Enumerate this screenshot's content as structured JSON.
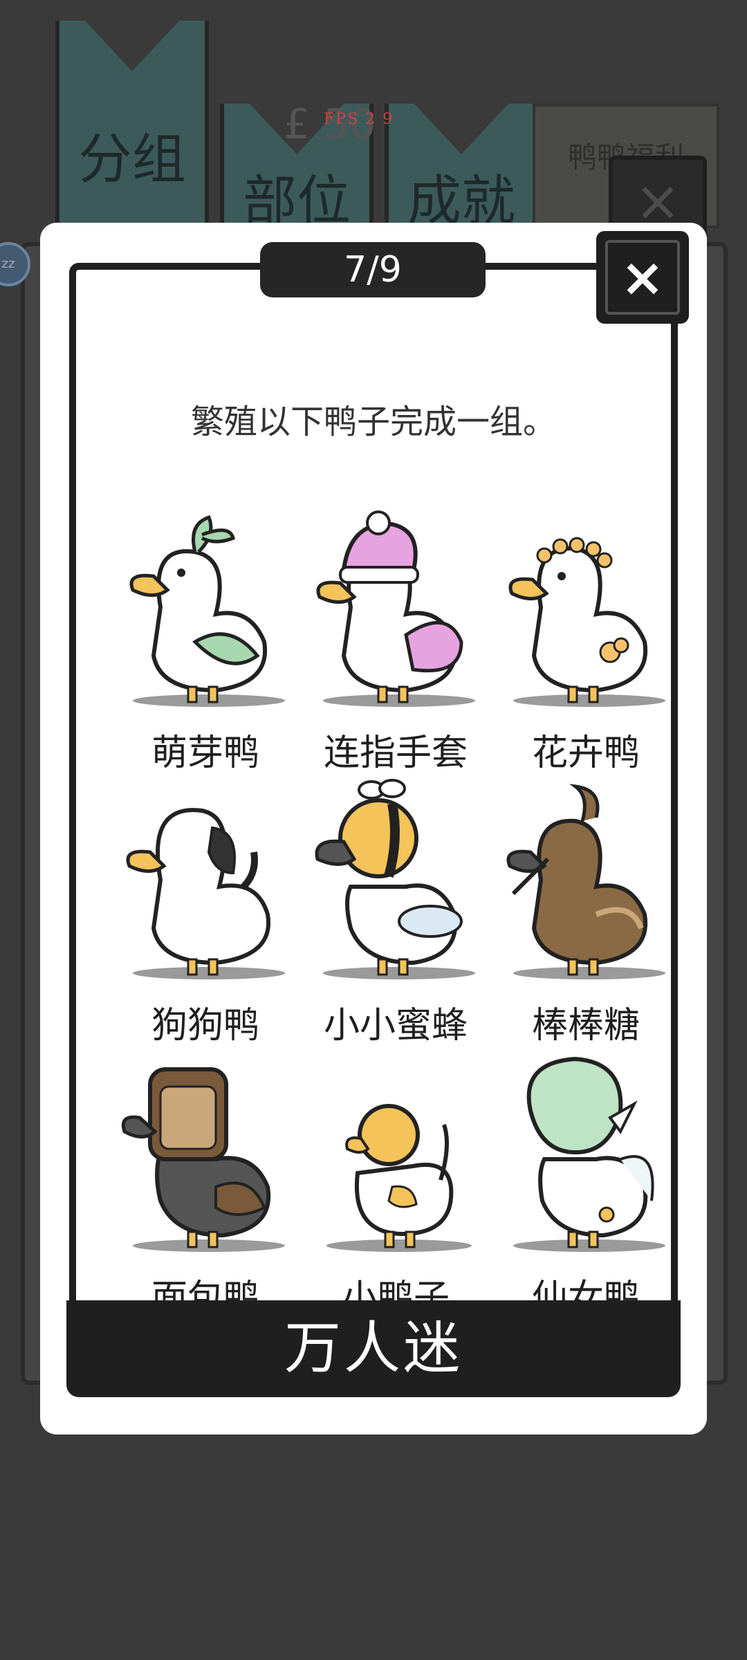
{
  "background": {
    "tabs": [
      "分组",
      "部位",
      "成就"
    ],
    "coin_text": "£ 50",
    "sign_text": "鸭鸭福利",
    "badge_text": "zz",
    "fps_text": "FPS 2 9"
  },
  "dialog": {
    "progress": "7/9",
    "close_label": "×",
    "description": "繁殖以下鸭子完成一组。",
    "group_name": "万人迷",
    "ducks": [
      {
        "name": "萌芽鸭",
        "icon": "sprout-duck-icon",
        "accent": "#a8d8b0"
      },
      {
        "name": "连指手套",
        "icon": "mitten-duck-icon",
        "accent": "#e7a3e0"
      },
      {
        "name": "花卉鸭",
        "icon": "flower-duck-icon",
        "accent": "#f5c26b"
      },
      {
        "name": "狗狗鸭",
        "icon": "dog-duck-icon",
        "accent": "#333333"
      },
      {
        "name": "小小蜜蜂",
        "icon": "bee-duck-icon",
        "accent": "#f4c35a"
      },
      {
        "name": "棒棒糖",
        "icon": "lollipop-duck-icon",
        "accent": "#8a6a45"
      },
      {
        "name": "面包鸭",
        "icon": "bread-duck-icon",
        "accent": "#7a5a3a"
      },
      {
        "name": "小鸭子",
        "icon": "duckling-icon",
        "accent": "#f4c35a"
      },
      {
        "name": "仙女鸭",
        "icon": "fairy-duck-icon",
        "accent": "#bfe3c5"
      }
    ]
  },
  "colors": {
    "overlay": "#3a3a3a",
    "panel": "#ffffff",
    "dark": "#1f1f1f",
    "duck_bill": "#f4c35a"
  }
}
